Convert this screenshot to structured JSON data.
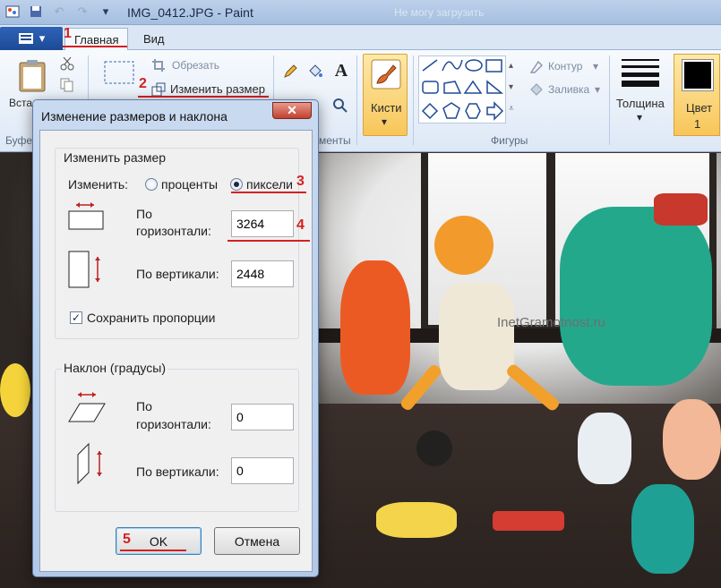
{
  "window": {
    "title": "IMG_0412.JPG - Paint",
    "faded_title": "Не могу загрузить"
  },
  "ribbon": {
    "app_menu_icon": "paint-menu-icon",
    "tabs": [
      {
        "label": "Главная"
      },
      {
        "label": "Вид"
      }
    ],
    "clipboard": {
      "paste_label": "Вста",
      "group_label": "Буфе"
    },
    "image": {
      "crop_label": "Обрезать",
      "resize_label": "Изменить размер"
    },
    "tools": {
      "group_label": "менты"
    },
    "brushes": {
      "label": "Кисти"
    },
    "shapes": {
      "outline_label": "Контур",
      "fill_label": "Заливка",
      "group_label": "Фигуры"
    },
    "size": {
      "label": "Толщина"
    },
    "color": {
      "label": "Цвет",
      "number": "1",
      "swatch": "#000000"
    }
  },
  "canvas": {
    "watermark": "InetGramotnost.ru"
  },
  "annotations": [
    "1",
    "2",
    "3",
    "4",
    "5"
  ],
  "dialog": {
    "title": "Изменение размеров и наклона",
    "close_glyph": "✕",
    "resize": {
      "legend": "Изменить размер",
      "by_label": "Изменить:",
      "percent_label": "проценты",
      "pixels_label": "пиксели",
      "selected": "pixels",
      "horizontal_label_1": "По",
      "horizontal_label_2": "горизонтали:",
      "horizontal_value": "3264",
      "vertical_label": "По вертикали:",
      "vertical_value": "2448",
      "keep_ratio_label": "Сохранить пропорции",
      "keep_ratio_checked": true
    },
    "skew": {
      "legend": "Наклон (градусы)",
      "horizontal_label_1": "По",
      "horizontal_label_2": "горизонтали:",
      "horizontal_value": "0",
      "vertical_label": "По вертикали:",
      "vertical_value": "0"
    },
    "ok_label": "OK",
    "cancel_label": "Отмена"
  },
  "colors": {
    "annotation_red": "#d52020",
    "accent_blue": "#1d4a96"
  }
}
